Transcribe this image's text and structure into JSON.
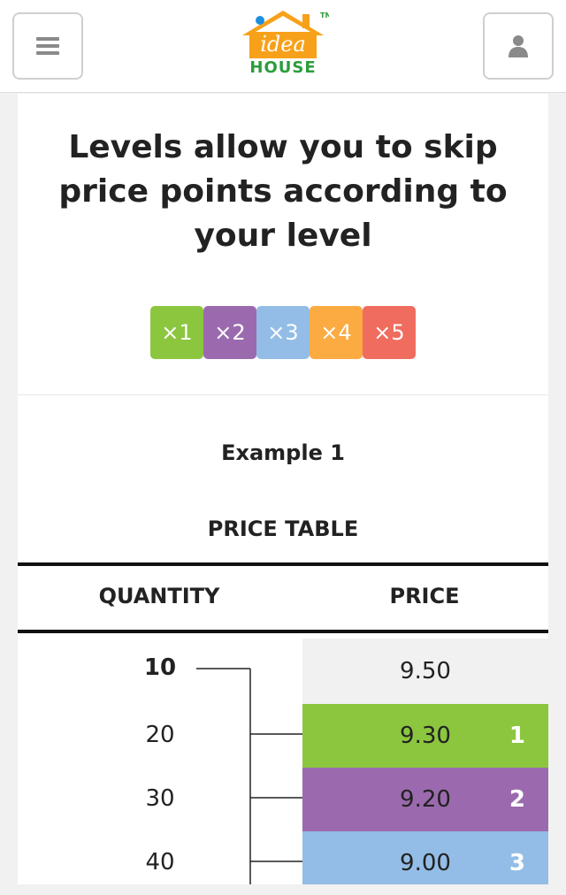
{
  "header": {
    "logo": {
      "word": "idea",
      "house": "HOUSE",
      "tm": "TM"
    },
    "menu_icon": "hamburger-icon",
    "account_icon": "user-icon"
  },
  "intro": {
    "headline": "Levels allow you to skip price points according to your level"
  },
  "levels": [
    {
      "label": "×1",
      "color": "#8cc63f"
    },
    {
      "label": "×2",
      "color": "#9b6aae"
    },
    {
      "label": "×3",
      "color": "#93bde6"
    },
    {
      "label": "×4",
      "color": "#fbab42"
    },
    {
      "label": "×5",
      "color": "#f06c5e"
    }
  ],
  "example": {
    "title": "Example 1",
    "table_title": "PRICE TABLE",
    "headers": {
      "quantity": "QUANTITY",
      "price": "PRICE"
    },
    "rows": [
      {
        "quantity": "10",
        "price": "9.50",
        "level": "",
        "color": "#f1f1f1"
      },
      {
        "quantity": "20",
        "price": "9.30",
        "level": "1",
        "color": "#8cc63f"
      },
      {
        "quantity": "30",
        "price": "9.20",
        "level": "2",
        "color": "#9b6aae"
      },
      {
        "quantity": "40",
        "price": "9.00",
        "level": "3",
        "color": "#93bde6"
      }
    ]
  },
  "colors": {
    "logo_orange": "#f7a11a",
    "logo_green": "#2a9d3a",
    "logo_blue": "#1e8fe0"
  }
}
